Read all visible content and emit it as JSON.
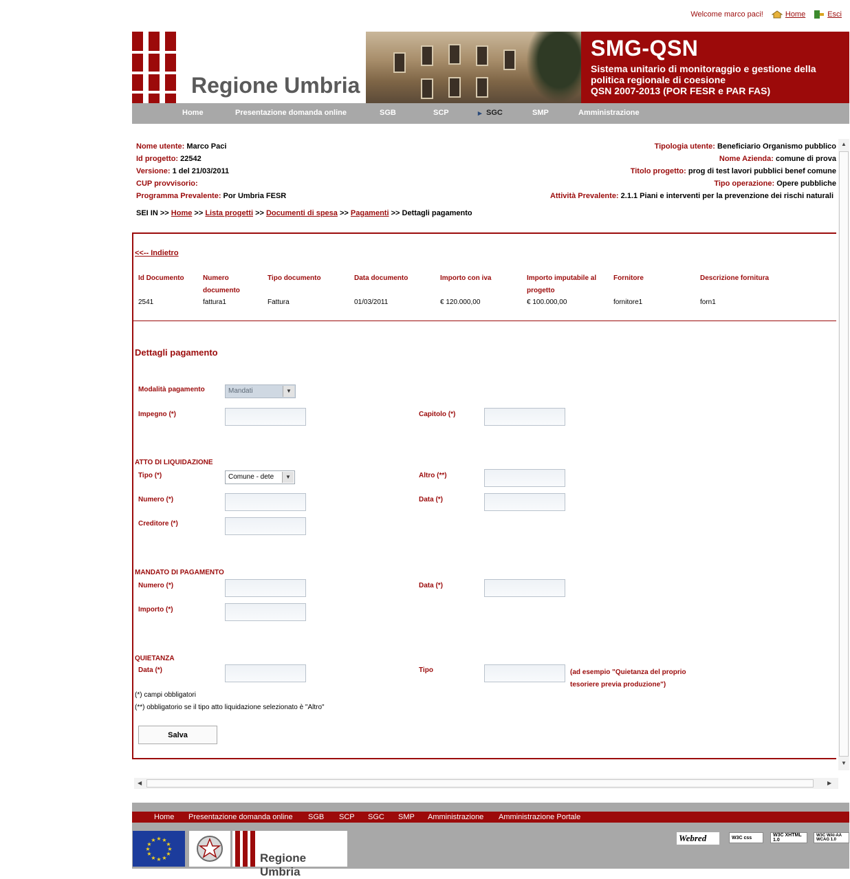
{
  "top": {
    "welcome": "Welcome marco paci!",
    "home": "Home",
    "exit": "Esci"
  },
  "banner": {
    "region": "Regione Umbria",
    "title": "SMG-QSN",
    "subtitle_1": "Sistema unitario di monitoraggio e gestione della",
    "subtitle_2": "politica regionale di coesione",
    "subtitle_3": "QSN 2007-2013 (POR FESR e PAR FAS)"
  },
  "nav": [
    "Home",
    "Presentazione domanda online",
    "SGB",
    "SCP",
    "SGC",
    "SMP",
    "Amministrazione"
  ],
  "info": {
    "left": [
      {
        "label": "Nome utente:",
        "value": " Marco Paci"
      },
      {
        "label": "Id progetto:",
        "value": " 22542"
      },
      {
        "label": "Versione:",
        "value": " 1 del 21/03/2011"
      },
      {
        "label": "CUP provvisorio:",
        "value": ""
      },
      {
        "label": "Programma Prevalente:",
        "value": " Por Umbria FESR"
      }
    ],
    "right": [
      {
        "label": "Tipologia utente:",
        "value": " Beneficiario  Organismo pubblico"
      },
      {
        "label": "Nome Azienda:",
        "value": " comune di prova"
      },
      {
        "label": "Titolo progetto:",
        "value": " prog di test lavori pubblici benef comune"
      },
      {
        "label": "Tipo operazione:",
        "value": "  Opere pubbliche"
      },
      {
        "label": "Attività Prevalente:",
        "value": " 2.1.1 Piani e interventi per la prevenzione dei rischi naturali"
      }
    ]
  },
  "breadcrumb": {
    "prefix": "SEI IN",
    "sep": ">>",
    "links": [
      "Home",
      "Lista progetti",
      "Documenti di spesa",
      "Pagamenti"
    ],
    "current": "Dettagli pagamento"
  },
  "back": "<<-- Indietro",
  "table": {
    "headers": [
      "Id Documento",
      "Numero documento",
      "Tipo documento",
      "Data documento",
      "Importo con iva",
      "Importo imputabile al progetto",
      "Fornitore",
      "Descrizione fornitura"
    ],
    "row": [
      "2541",
      "fattura1",
      "Fattura",
      "01/03/2011",
      "€ 120.000,00",
      "€ 100.000,00",
      "fornitore1",
      "forn1"
    ]
  },
  "form": {
    "title": "Dettagli pagamento",
    "modalita_label": "Modalità pagamento",
    "modalita_value": "Mandati",
    "impegno_label": "Impegno  (*)",
    "capitolo_label": "Capitolo  (*)",
    "atto_section": "ATTO DI LIQUIDAZIONE",
    "tipo_label": "Tipo  (*)",
    "tipo_value": "Comune - dete",
    "altro_label": "Altro  (**)",
    "numero_label": "Numero  (*)",
    "data_label": "Data  (*)",
    "creditore_label": "Creditore  (*)",
    "mandato_section": "MANDATO DI PAGAMENTO",
    "importo_label": "Importo  (*)",
    "quietanza_section": "QUIETANZA",
    "q_tipo_label": "Tipo",
    "q_hint_1": "(ad esempio \"Quietanza del proprio",
    "q_hint_2": "tesoriere previa produzione\")",
    "note_1": "(*) campi obbligatori",
    "note_2": "(**) obbligatorio se il tipo atto liquidazione selezionato è \"Altro\"",
    "save": "Salva"
  },
  "footer": {
    "nav": [
      "Home",
      "Presentazione domanda online",
      "SGB",
      "SCP",
      "SGC",
      "SMP",
      "Amministrazione",
      "Amministrazione Portale"
    ],
    "region": "Regione Umbria",
    "badges": [
      "Webred",
      "W3C css",
      "W3C XHTML 1.0",
      "W3C WAI-AA WCAG 1.0"
    ]
  },
  "colors": {
    "brand": "#9c0a0a",
    "nav_gray": "#a8a8a8"
  }
}
